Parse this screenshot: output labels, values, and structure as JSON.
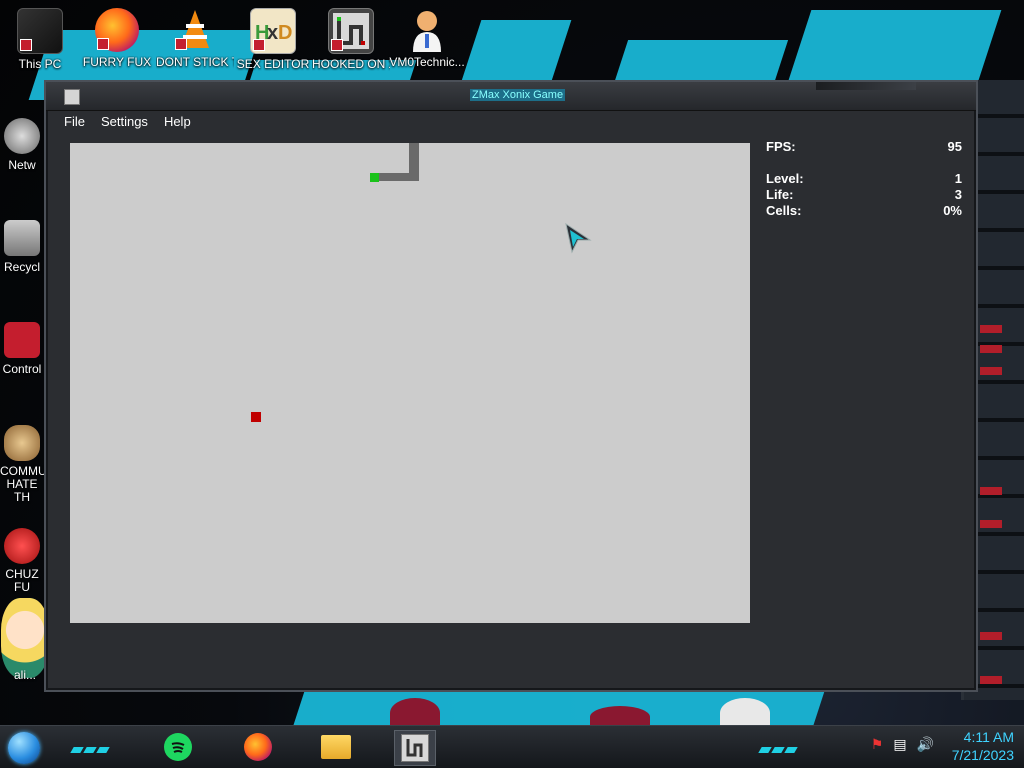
{
  "desktop": {
    "top_icons": [
      {
        "label": "This PC",
        "icon": "computer-icon"
      },
      {
        "label": "FURRY FUX",
        "icon": "firefox-icon"
      },
      {
        "label": "DONT STICK THIS IN YO...",
        "icon": "vlc-cone-icon"
      },
      {
        "label": "SEX EDITOR",
        "icon": "hxd-icon"
      },
      {
        "label": "HOOKED ON XONIX",
        "icon": "xonix-icon"
      },
      {
        "label": "VM0Technic...",
        "icon": "doctor-icon"
      }
    ],
    "left_icons": [
      {
        "label": "Netw",
        "icon": "network-icon"
      },
      {
        "label": "Recycl",
        "icon": "recycle-bin-icon"
      },
      {
        "label": "Control",
        "icon": "control-panel-icon"
      },
      {
        "label": "COMMU HATE TH",
        "icon": "money-bag-icon"
      },
      {
        "label": "CHUZ FU",
        "icon": "red-face-icon"
      },
      {
        "label": "ali...",
        "icon": "star-girl-icon"
      }
    ]
  },
  "window": {
    "title": "ZMax Xonix Game",
    "menu": [
      "File",
      "Settings",
      "Help"
    ]
  },
  "stats": {
    "fps_label": "FPS:",
    "fps_value": "95",
    "level_label": "Level:",
    "level_value": "1",
    "life_label": "Life:",
    "life_value": "3",
    "cells_label": "Cells:",
    "cells_value": "0%"
  },
  "taskbar": {
    "apps": [
      {
        "name": "spotify",
        "icon": "spotify-icon"
      },
      {
        "name": "firefox",
        "icon": "firefox-icon"
      },
      {
        "name": "explorer",
        "icon": "folder-icon"
      },
      {
        "name": "xonix",
        "icon": "xonix-icon",
        "active": true
      }
    ],
    "tray_icons": [
      "flag-icon",
      "network-icon",
      "volume-icon"
    ],
    "time": "4:11 AM",
    "date": "7/21/2023"
  },
  "colors": {
    "game_field": "#cccccc",
    "player": "#1ac21a",
    "enemy": "#c00000",
    "trail": "#6a6a6a",
    "clock": "#3fd3ff"
  }
}
